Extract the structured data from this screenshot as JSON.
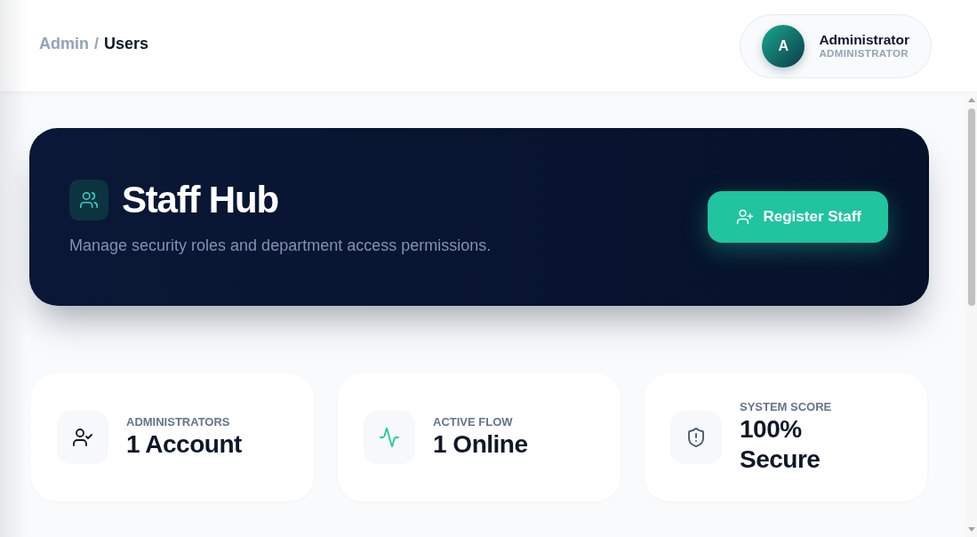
{
  "breadcrumb": {
    "separator": "/",
    "items": [
      {
        "label": "Admin",
        "current": false
      },
      {
        "label": "Users",
        "current": true
      }
    ]
  },
  "user": {
    "initial": "A",
    "name": "Administrator",
    "role": "ADMINISTRATOR"
  },
  "hero": {
    "title": "Staff Hub",
    "subtitle": "Manage security roles and department access permissions.",
    "button": "Register Staff"
  },
  "stats": [
    {
      "kind": "admins",
      "label": "ADMINISTRATORS",
      "value": "1 Account"
    },
    {
      "kind": "activity",
      "label": "ACTIVE FLOW",
      "value": "1 Online"
    },
    {
      "kind": "security",
      "label": "SYSTEM SCORE",
      "value": "100% Secure"
    }
  ]
}
